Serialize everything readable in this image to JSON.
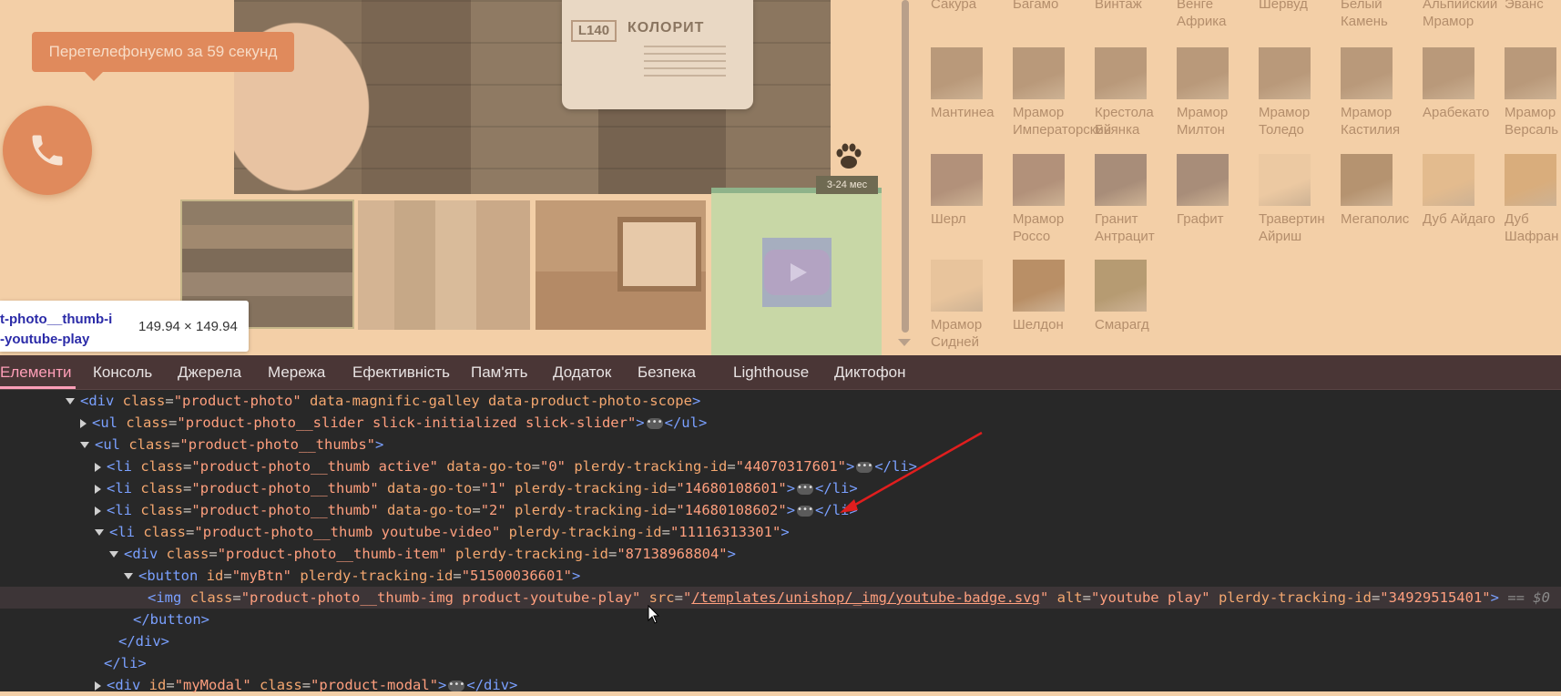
{
  "page": {
    "callback_text": "Перетелефонуємо за 59 секунд",
    "age_badge": "3-24 мес",
    "product_label": {
      "code": "L140",
      "name": "КОЛОРИТ"
    },
    "inspect_tooltip": {
      "class_line1": "t-photo__thumb-i",
      "class_line2": "-youtube-play",
      "size": "149.94 × 149.94"
    },
    "swatches": [
      {
        "name": "Сакура",
        "color": "#f3cfa7",
        "image": false
      },
      {
        "name": "Багамо",
        "color": "#f3cfa7",
        "image": false
      },
      {
        "name": "Винтаж",
        "color": "#f3cfa7",
        "image": false
      },
      {
        "name": "Венге Африка",
        "color": "#f3cfa7",
        "image": false
      },
      {
        "name": "Шервуд",
        "color": "#f3cfa7",
        "image": false
      },
      {
        "name": "Белый Камень",
        "color": "#f3cfa7",
        "image": false
      },
      {
        "name": "Альпийский Мрамор",
        "color": "#f3cfa7",
        "image": false
      },
      {
        "name": "Эванс",
        "color": "#f3cfa7",
        "image": false
      },
      {
        "name": "Мантинеа",
        "color": "#b9997a",
        "image": true
      },
      {
        "name": "Мрамор Императорский",
        "color": "#b9997a",
        "image": true
      },
      {
        "name": "Крестола Бьянка",
        "color": "#b9997a",
        "image": true
      },
      {
        "name": "Мрамор Милтон",
        "color": "#b9997a",
        "image": true
      },
      {
        "name": "Мрамор Толедо",
        "color": "#b9997a",
        "image": true
      },
      {
        "name": "Мрамор Кастилия",
        "color": "#b9997a",
        "image": true
      },
      {
        "name": "Арабекато",
        "color": "#b9997a",
        "image": true
      },
      {
        "name": "Мрамор Версаль",
        "color": "#b9997a",
        "image": true
      },
      {
        "name": "Шерл",
        "color": "#b2917a",
        "image": true
      },
      {
        "name": "Мрамор Россо",
        "color": "#b2917a",
        "image": true
      },
      {
        "name": "Гранит Антрацит",
        "color": "#a88d79",
        "image": true
      },
      {
        "name": "Графит",
        "color": "#a88d79",
        "image": true
      },
      {
        "name": "Травертин Айриш",
        "color": "#ecc9a2",
        "image": true
      },
      {
        "name": "Мегаполис",
        "color": "#b59370",
        "image": true
      },
      {
        "name": "Дуб Айдаго",
        "color": "#e3bb8e",
        "image": true
      },
      {
        "name": "Дуб Шафран",
        "color": "#d9ad7c",
        "image": true
      },
      {
        "name": "Мрамор Сидней",
        "color": "#e8c49c",
        "image": true
      },
      {
        "name": "Шелдон",
        "color": "#b98f66",
        "image": true
      },
      {
        "name": "Смарагд",
        "color": "#b69b72",
        "image": true
      }
    ]
  },
  "devtools": {
    "tabs": [
      "Елементи",
      "Консоль",
      "Джерела",
      "Мережа",
      "Ефективність",
      "Пам'ять",
      "Додаток",
      "Безпека",
      "Lighthouse",
      "Диктофон"
    ],
    "active_tab": "Елементи",
    "selected_suffix": "== $0"
  },
  "colors": {
    "accent": "#e08a5c",
    "devtools_tabbar": "#4a3636",
    "devtools_bg": "#282828",
    "tag": "#7aa0ff",
    "attr_name": "#f4a76f",
    "attr_value": "#ff9f7e",
    "arrow": "#e01e1e"
  },
  "icons": [
    "phone-icon",
    "paw-icon",
    "play-icon",
    "expand-triangle-icon",
    "collapse-triangle-icon",
    "ellipsis-icon",
    "mouse-cursor-icon"
  ]
}
